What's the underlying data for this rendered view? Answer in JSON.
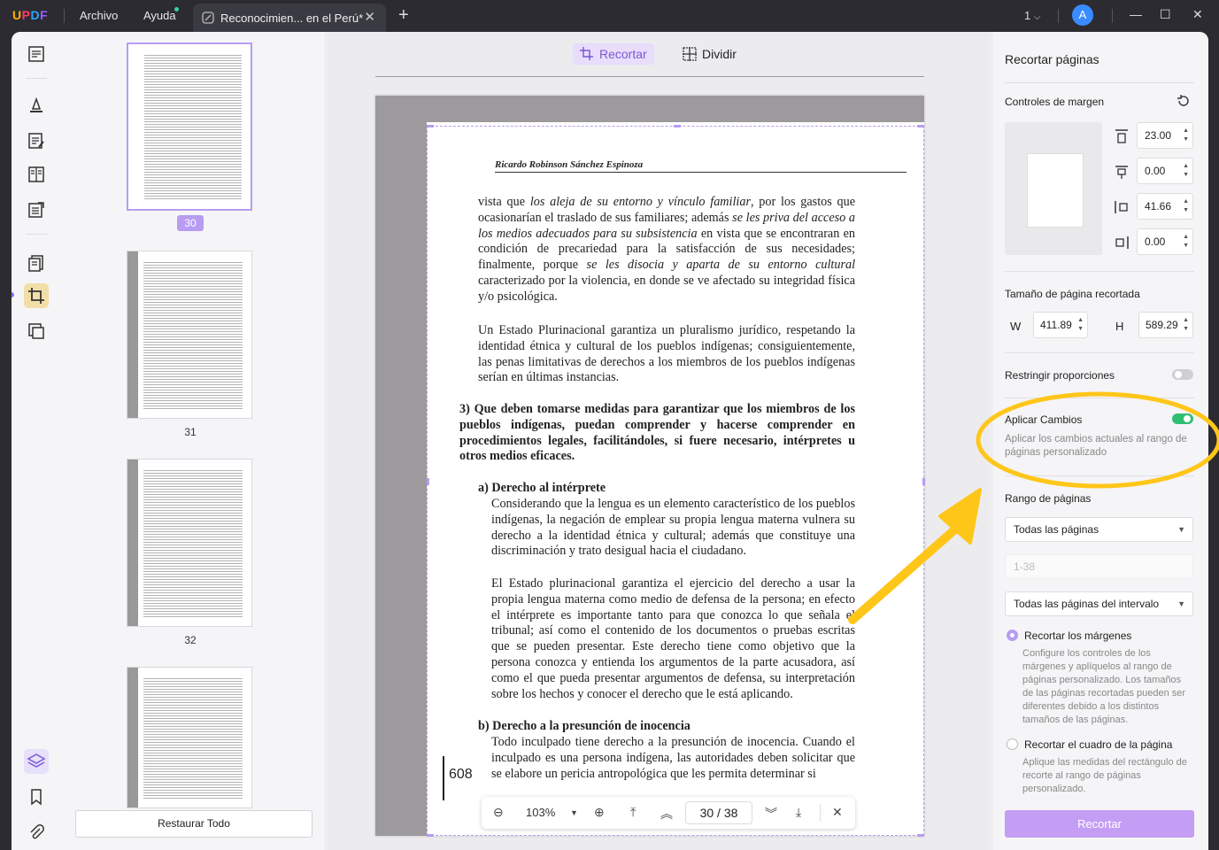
{
  "titlebar": {
    "logo": "UPDF",
    "menu_file": "Archivo",
    "menu_help": "Ayuda",
    "tab_title": "Reconocimien... en el Perú*",
    "page_indicator": "1",
    "avatar_letter": "A"
  },
  "thumbnails": {
    "pages": [
      "30",
      "31",
      "32"
    ],
    "restore_label": "Restaurar Todo"
  },
  "doc_toolbar": {
    "crop_label": "Recortar",
    "split_label": "Dividir"
  },
  "page": {
    "header": "Ricardo Robinson Sánchez Espinoza",
    "para1_html": "vista que <i>los aleja de su entorno y vínculo familiar</i>, por los gastos que ocasionarían el traslado de sus familiares; además <i>se les priva del acceso a los medios adecuados para su subsistencia</i> en vista que se encontraran en condición de precariedad para la satisfacción de sus necesidades; finalmente, porque <i>se les disocia y aparta de su entorno cultural</i> caracterizado por la violencia, en donde se ve afectado su integridad física y/o psicológica.",
    "para2": "Un Estado Plurinacional garantiza un pluralismo jurídico, respetando la identidad étnica y cultural de los pueblos indígenas; consiguientemente, las penas limitativas de derechos a los miembros de los pueblos indígenas serían en últimas instancias.",
    "heading3": "3) Que deben tomarse medidas para garantizar  que los miembros de los pueblos indígenas, puedan comprender y hacerse comprender en procedimientos legales, facilitándoles, si fuere necesario, intérpretes u otros medios eficaces.",
    "heading_a": "a) Derecho al intérprete",
    "para_a1": "Considerando que la lengua es un elemento característico de los pueblos indígenas, la negación de emplear su propia lengua materna vulnera su derecho a la identidad étnica y cultural; además que constituye una discriminación y trato desigual hacia el ciudadano.",
    "para_a2": "El Estado plurinacional garantiza el ejercicio del derecho a usar la propia lengua materna como medio de defensa de la persona; en efecto el intérprete es importante tanto para que conozca lo que señala el tribunal; así como el contenido de los documentos o pruebas escritas que se pueden presentar. Este derecho tiene como objetivo que la persona conozca y entienda los argumentos de la parte acusadora, así como el que pueda presentar argumentos de defensa, su interpretación sobre los hechos y conocer el derecho que le está aplicando.",
    "heading_b": "b) Derecho a la presunción de inocencia",
    "para_b1": "Todo inculpado tiene derecho a la presunción de inocencia. Cuando el inculpado es una persona  indígena, las autoridades deben solicitar que se elabore un pericia antropológica que les permita determinar si",
    "page_number": "608"
  },
  "navbar": {
    "zoom": "103%",
    "current_page": "30",
    "total_pages": "38",
    "separator": "/"
  },
  "right_panel": {
    "title": "Recortar páginas",
    "margin_controls": "Controles de margen",
    "margin_top": "23.00",
    "margin_bottom": "0.00",
    "margin_left": "41.66",
    "margin_right": "0.00",
    "cropped_size_label": "Tamaño de página recortada",
    "w_label": "W",
    "w_value": "411.89",
    "h_label": "H",
    "h_value": "589.29",
    "keep_ratio_label": "Restringir proporciones",
    "keep_ratio_on": false,
    "apply_changes_label": "Aplicar Cambios",
    "apply_changes_on": true,
    "apply_changes_desc": "Aplicar los cambios actuales al rango de páginas personalizado",
    "page_range_label": "Rango de páginas",
    "range_select": "Todas las páginas",
    "range_input_placeholder": "1-38",
    "interval_select": "Todas las páginas del intervalo",
    "radio_margins_label": "Recortar los márgenes",
    "radio_margins_desc": "Configure los controles de los márgenes y aplíquelos al rango de páginas personalizado. Los tamaños de las páginas recortadas pueden ser diferentes debido a los distintos tamaños de las páginas.",
    "radio_box_label": "Recortar el cuadro de la página",
    "radio_box_desc": "Aplique las medidas del rectángulo de recorte al rango de páginas personalizado.",
    "crop_button": "Recortar"
  },
  "colors": {
    "accent": "#b79cf2",
    "toggle_on": "#2fbf71",
    "annotation": "#ffc61a"
  }
}
